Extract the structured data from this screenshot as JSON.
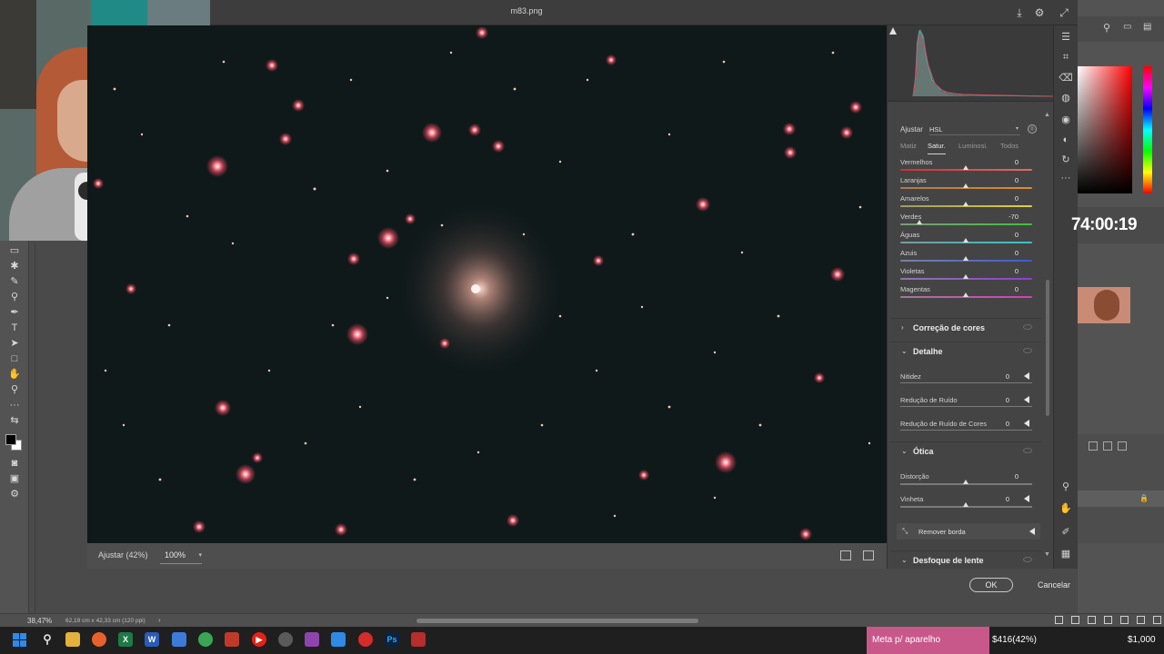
{
  "window": {
    "document_title": "m83.png"
  },
  "camera_raw": {
    "adjust": {
      "label": "Ajustar",
      "selected": "HSL"
    },
    "hsl_tabs": [
      "Matiz",
      "Satur.",
      "Luminosi.",
      "Todos"
    ],
    "active_tab_index": 1,
    "hsl_sliders": [
      {
        "name": "Vermelhos",
        "value": "0",
        "level": 0,
        "color_left": "#d12f2f",
        "color_right": "#e06b6b"
      },
      {
        "name": "Laranjas",
        "value": "0",
        "level": 0,
        "color_left": "#a97a52",
        "color_right": "#e08a2e"
      },
      {
        "name": "Amarelos",
        "value": "0",
        "level": 0,
        "color_left": "#9c9a6a",
        "color_right": "#e3d13a"
      },
      {
        "name": "Verdes",
        "value": "-70",
        "level": -70,
        "color_left": "#7e9a7e",
        "color_right": "#3cc23c"
      },
      {
        "name": "Águas",
        "value": "0",
        "level": 0,
        "color_left": "#7a9aa0",
        "color_right": "#37c4c8"
      },
      {
        "name": "Azuis",
        "value": "0",
        "level": 0,
        "color_left": "#7a7fa6",
        "color_right": "#3e5ad6"
      },
      {
        "name": "Violetas",
        "value": "0",
        "level": 0,
        "color_left": "#8a7aa6",
        "color_right": "#8c3ed6"
      },
      {
        "name": "Magentas",
        "value": "0",
        "level": 0,
        "color_left": "#a07a96",
        "color_right": "#d63ebc"
      }
    ],
    "sections": {
      "color_correction": "Correção de cores",
      "detail": "Detalhe",
      "optics": "Ótica",
      "lens_blur": "Desfoque de lente"
    },
    "detail_sliders": [
      {
        "name": "Nitidez",
        "value": "0"
      },
      {
        "name": "Redução de Ruído",
        "value": "0"
      },
      {
        "name": "Redução de Ruído de Cores",
        "value": "0"
      }
    ],
    "optics_sliders": [
      {
        "name": "Distorção",
        "value": "0"
      },
      {
        "name": "Vinheta",
        "value": "0"
      }
    ],
    "remove_fringe": "Remover borda"
  },
  "canvas": {
    "fit_label": "Ajustar (42%)",
    "zoom_value": "100%"
  },
  "dialog": {
    "ok": "OK",
    "cancel": "Cancelar"
  },
  "status": {
    "zoom": "38,47%",
    "doc_size": "62,19 cm x 42,33 cm (120 ppi)"
  },
  "stream": {
    "timer": "74:00:19",
    "goal_label": "Meta p/ aparelho",
    "goal_progress": "$416(42%)",
    "goal_target": "$1,000",
    "goal_fraction": 0.42
  },
  "icons": {
    "zoom": "zoom-icon",
    "hand": "hand-icon",
    "settings": "gear-icon"
  }
}
